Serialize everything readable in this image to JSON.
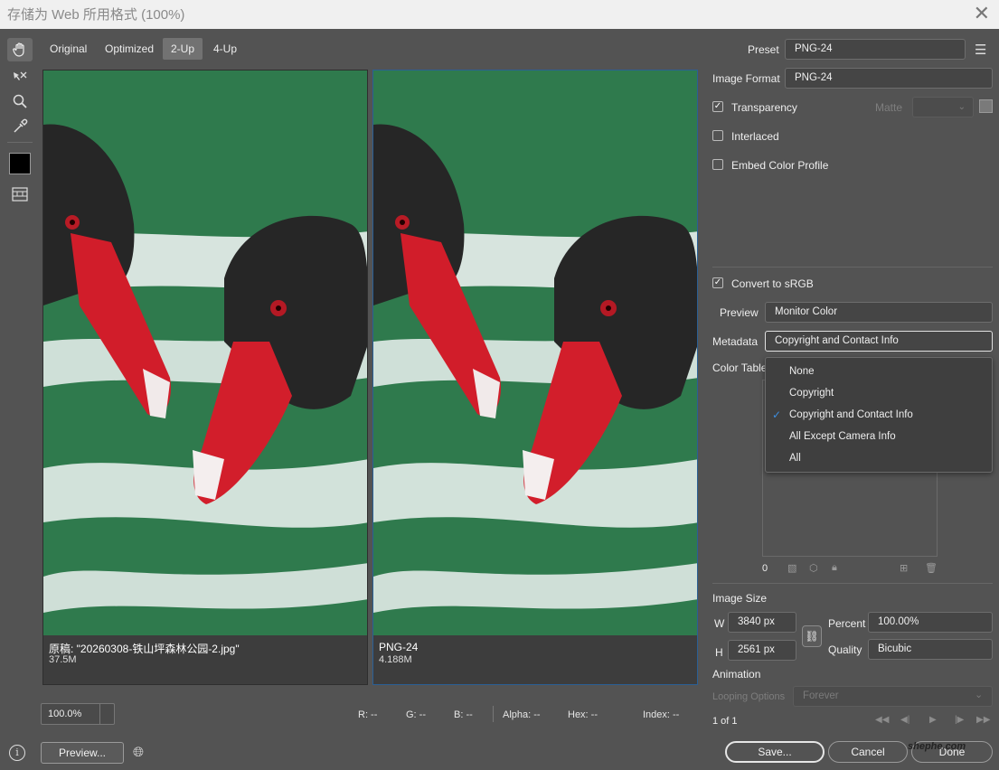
{
  "window": {
    "title": "存储为 Web 所用格式 (100%)",
    "close_icon": "close-icon"
  },
  "tools": [
    "hand-icon",
    "slice-select-icon",
    "zoom-icon",
    "eyedropper-icon",
    "color-swatch",
    "toggle-slices-icon"
  ],
  "tabs": [
    {
      "label": "Original",
      "active": false
    },
    {
      "label": "Optimized",
      "active": false
    },
    {
      "label": "2-Up",
      "active": true
    },
    {
      "label": "4-Up",
      "active": false
    }
  ],
  "panes": {
    "left": {
      "caption": "原稿: \"20260308-铁山坪森林公园-2.jpg\"",
      "size": "37.5M"
    },
    "right": {
      "caption": "PNG-24",
      "size": "4.188M"
    }
  },
  "settings": {
    "preset_label": "Preset",
    "preset_value": "PNG-24",
    "image_format_label": "Image Format",
    "image_format_value": "PNG-24",
    "transparency_label": "Transparency",
    "transparency_checked": true,
    "matte_label": "Matte",
    "interlaced_label": "Interlaced",
    "interlaced_checked": false,
    "embed_profile_label": "Embed Color Profile",
    "embed_profile_checked": false,
    "convert_srgb_label": "Convert to sRGB",
    "convert_srgb_checked": true,
    "preview_label": "Preview",
    "preview_value": "Monitor Color",
    "metadata_label": "Metadata",
    "metadata_value": "Copyright and Contact Info",
    "color_table_label": "Color Table",
    "color_count": "0"
  },
  "metadata_options": [
    {
      "label": "None",
      "checked": false
    },
    {
      "label": "Copyright",
      "checked": false
    },
    {
      "label": "Copyright and Contact Info",
      "checked": true
    },
    {
      "label": "All Except Camera Info",
      "checked": false
    },
    {
      "label": "All",
      "checked": false
    }
  ],
  "check_mark": "✓",
  "image_size": {
    "title": "Image Size",
    "w_label": "W",
    "w_value": "3840 px",
    "h_label": "H",
    "h_value": "2561 px",
    "percent_label": "Percent",
    "percent_value": "100.00%",
    "quality_label": "Quality",
    "quality_value": "Bicubic"
  },
  "animation": {
    "title": "Animation",
    "looping_label": "Looping Options",
    "looping_value": "Forever",
    "frame_counter": "1 of 1"
  },
  "status": {
    "zoom": "100.0%",
    "r": "R:  --",
    "g": "G:  --",
    "b": "B:  --",
    "alpha": "Alpha:  --",
    "hex": "Hex:  --",
    "index": "Index:  --"
  },
  "footer": {
    "preview_button": "Preview...",
    "save_button": "Save...",
    "cancel_button": "Cancel",
    "done_button": "Done",
    "watermark": "shephe.com"
  },
  "colors": {
    "accent": "#3d8ee0",
    "panel_bg": "#535353",
    "selected_border": "#2a5f95"
  }
}
